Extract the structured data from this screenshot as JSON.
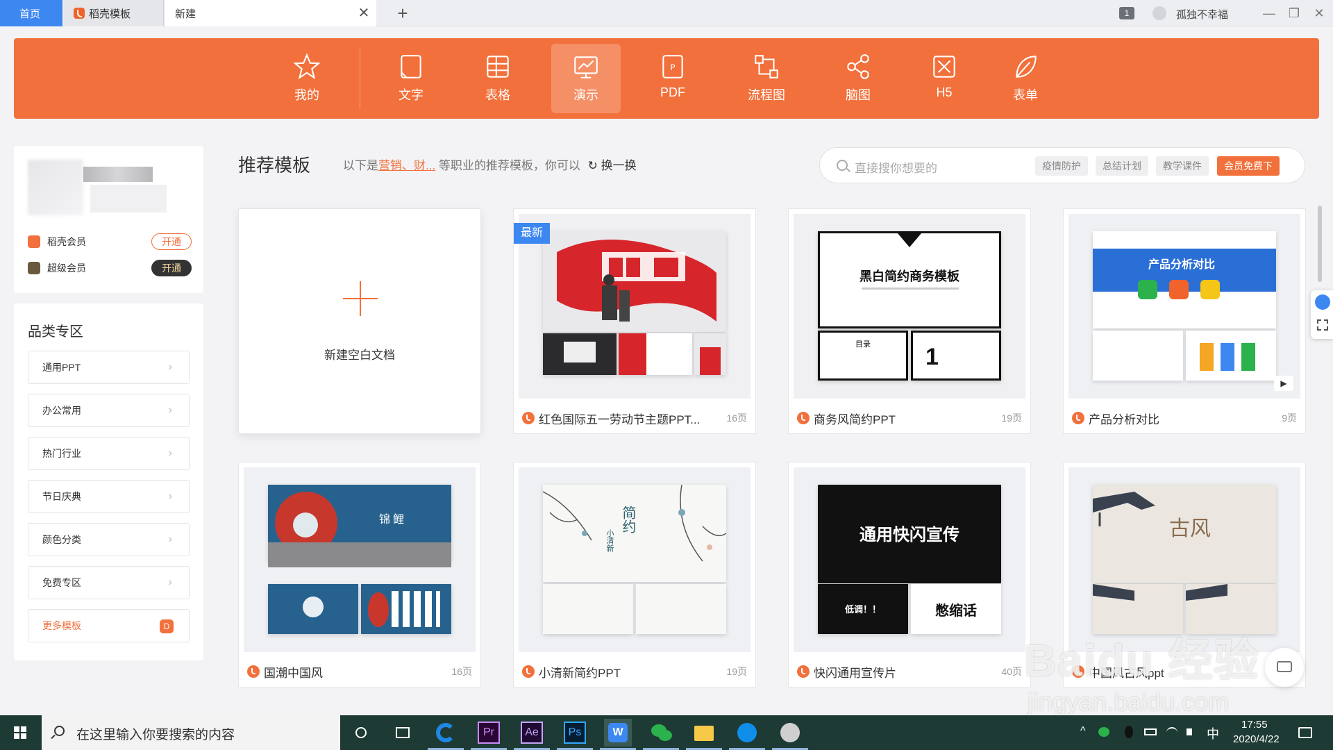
{
  "tabs": {
    "home": "首页",
    "docer": "稻壳模板",
    "new": "新建",
    "close": "✕",
    "add": "+"
  },
  "titlebar": {
    "count": "1",
    "username": "孤独不幸福",
    "minimize": "—",
    "restore": "❐",
    "close": "✕"
  },
  "categories": [
    {
      "label": "我的",
      "icon": "star-icon"
    },
    {
      "label": "文字",
      "icon": "doc-icon"
    },
    {
      "label": "表格",
      "icon": "table-icon"
    },
    {
      "label": "演示",
      "icon": "presentation-icon",
      "active": true
    },
    {
      "label": "PDF",
      "icon": "pdf-icon"
    },
    {
      "label": "流程图",
      "icon": "flowchart-icon"
    },
    {
      "label": "脑图",
      "icon": "mindmap-icon"
    },
    {
      "label": "H5",
      "icon": "h5-icon"
    },
    {
      "label": "表单",
      "icon": "form-icon"
    }
  ],
  "user": {
    "docer_vip": "稻壳会员",
    "docer_vip_btn": "开通",
    "super_vip": "超级会员",
    "super_vip_btn": "开通"
  },
  "category_zone": {
    "title": "品类专区",
    "items": [
      "通用PPT",
      "办公常用",
      "热门行业",
      "节日庆典",
      "颜色分类",
      "免费专区"
    ],
    "more": "更多模板",
    "chevron": "›"
  },
  "recommend": {
    "title": "推荐模板",
    "desc_prefix": "以下是",
    "desc_highlight": "营销、财...",
    "desc_suffix": "等职业的推荐模板，你可以",
    "swap": "换一换",
    "swap_icon": "↻"
  },
  "search": {
    "placeholder": "直接搜你想要的",
    "tags": [
      "疫情防护",
      "总结计划",
      "教学课件"
    ],
    "vip_tag": "会员免费下"
  },
  "new_doc": {
    "label": "新建空白文档"
  },
  "cards": [
    {
      "name": "红色国际五一劳动节主题PPT...",
      "pages": "16页",
      "badge": "最新"
    },
    {
      "name": "商务风简约PPT",
      "pages": "19页",
      "slide_title": "黑白简约商务模板",
      "toc": "目录",
      "num": "1"
    },
    {
      "name": "产品分析对比",
      "pages": "9页",
      "slide_title": "产品分析对比"
    },
    {
      "name": "国潮中国风",
      "pages": "16页",
      "slide_title": "锦鲤"
    },
    {
      "name": "小清新简约PPT",
      "pages": "19页",
      "slide_title": "简约",
      "slide_sub": "小清新"
    },
    {
      "name": "快闪通用宣传片",
      "pages": "40页",
      "slide_title": "通用快闪宣传",
      "low": "低调！！",
      "cut": "憋缩话"
    },
    {
      "name": "中国风古风ppt",
      "pages": "",
      "slide_title": "古风"
    }
  ],
  "watermark": {
    "main": "Baidu 经验",
    "sub": "jingyan.baidu.com"
  },
  "taskbar": {
    "search_placeholder": "在这里输入你要搜索的内容",
    "time": "17:55",
    "date": "2020/4/22",
    "ime": "中",
    "apps": [
      "cortana-icon",
      "taskview-icon",
      "edge-icon",
      "premiere-icon",
      "aftereffects-icon",
      "photoshop-icon",
      "wps-icon",
      "wechat-icon",
      "explorer-icon",
      "teamviewer-icon",
      "avatar-app-icon"
    ],
    "pr": "Pr",
    "ae": "Ae",
    "ps": "Ps",
    "wps": "W"
  },
  "colors": {
    "accent": "#f2703b",
    "blue": "#3d87f1",
    "taskbar": "#1e3a34"
  }
}
